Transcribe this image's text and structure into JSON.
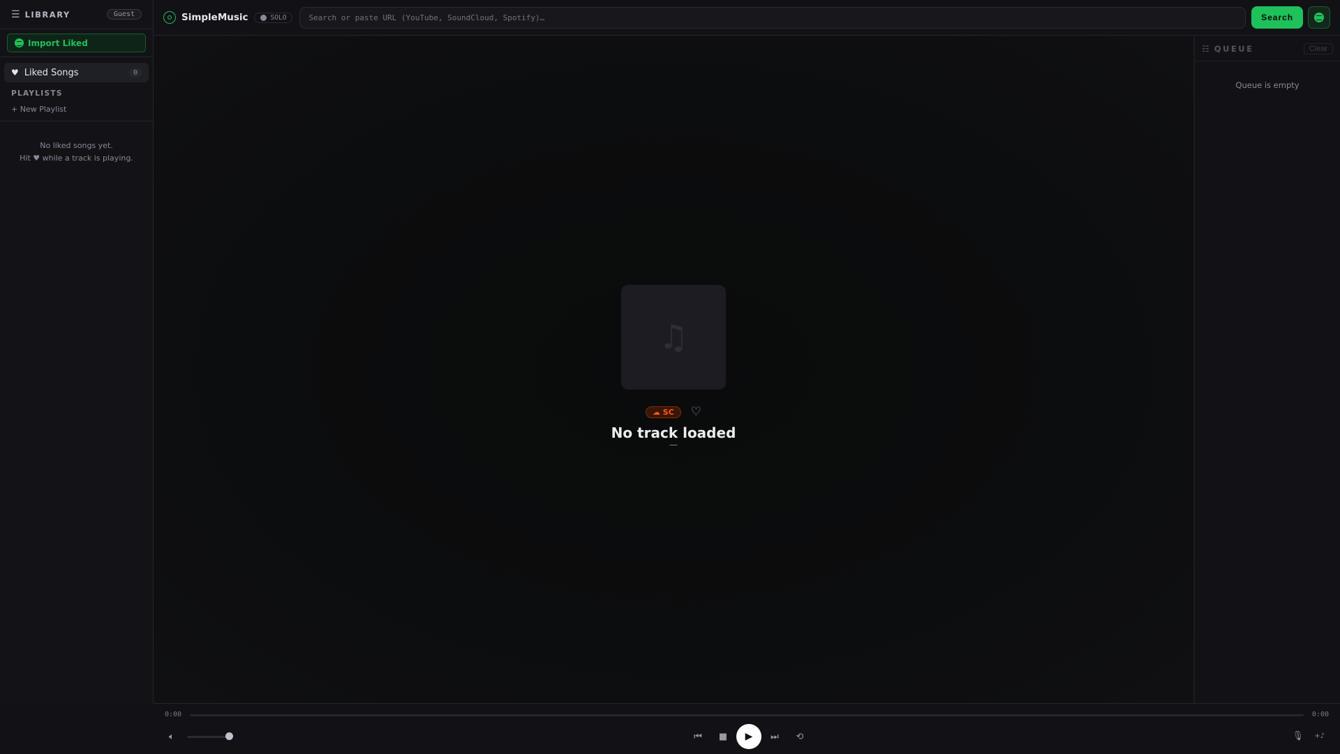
{
  "sidebar": {
    "title": "LIBRARY",
    "user_badge": "Guest",
    "import_label": "Import Liked",
    "liked_label": "Liked Songs",
    "liked_count": "0",
    "playlists_heading": "PLAYLISTS",
    "new_playlist": "+ New Playlist",
    "empty_line1": "No liked songs yet.",
    "empty_line2": "Hit ♥ while a track is playing."
  },
  "topbar": {
    "brand": "SimpleMusic",
    "mode_badge": "SOLO",
    "search_placeholder": "Search or paste URL (YouTube, SoundCloud, Spotify)…",
    "search_label": "Search"
  },
  "player": {
    "source_badge": "☁ SC",
    "title": "No track loaded",
    "subtitle": "—",
    "elapsed": "0:00",
    "duration": "0:00",
    "volume_percent": 83,
    "progress_percent": 0
  },
  "queue": {
    "title": "QUEUE",
    "clear_label": "Clear",
    "empty": "Queue is empty"
  },
  "colors": {
    "accent": "#1ec15a",
    "soundcloud": "#ff5a14"
  }
}
